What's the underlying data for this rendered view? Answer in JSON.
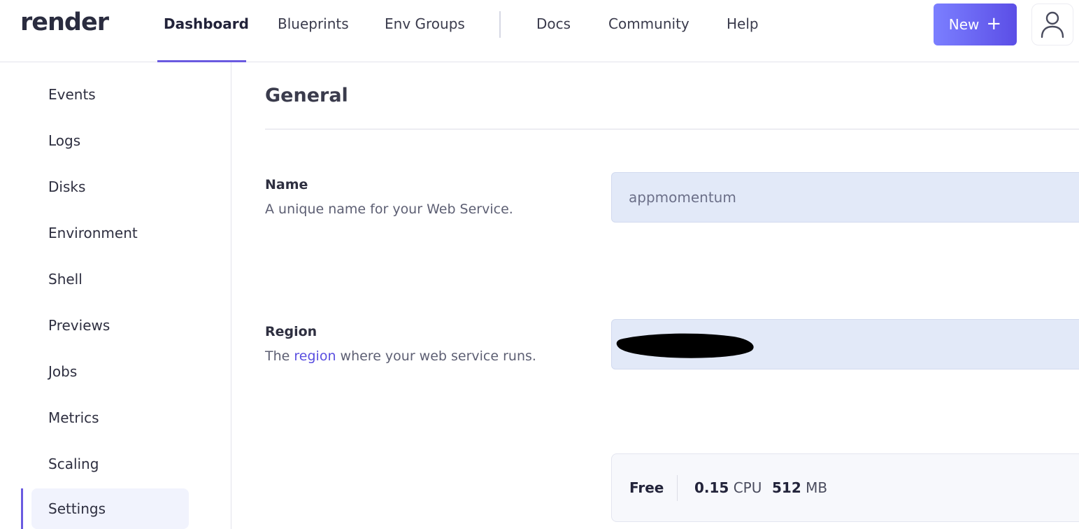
{
  "brand": {
    "logo_text": "render"
  },
  "topnav": {
    "items": [
      {
        "label": "Dashboard",
        "active": true
      },
      {
        "label": "Blueprints"
      },
      {
        "label": "Env Groups"
      },
      {
        "label": "Docs"
      },
      {
        "label": "Community"
      },
      {
        "label": "Help"
      }
    ],
    "new_button": {
      "label": "New",
      "icon": "plus-icon"
    },
    "avatar": {
      "icon": "user-icon"
    },
    "accent_color": "#6a5ae0"
  },
  "sidebar": {
    "items": [
      {
        "label": "Events"
      },
      {
        "label": "Logs"
      },
      {
        "label": "Disks"
      },
      {
        "label": "Environment"
      },
      {
        "label": "Shell"
      },
      {
        "label": "Previews"
      },
      {
        "label": "Jobs"
      },
      {
        "label": "Metrics"
      },
      {
        "label": "Scaling"
      },
      {
        "label": "Settings",
        "active": true
      }
    ]
  },
  "main": {
    "section_title": "General",
    "name_field": {
      "label": "Name",
      "description": "A unique name for your Web Service.",
      "value": "appmomentum"
    },
    "region_field": {
      "label": "Region",
      "description_prefix": "The ",
      "description_link": "region",
      "description_suffix": " where your web service runs.",
      "value_redacted": true
    },
    "plan": {
      "name": "Free",
      "cpu_value": "0.15",
      "cpu_unit": "CPU",
      "memory_value": "512",
      "memory_unit": "MB"
    }
  }
}
